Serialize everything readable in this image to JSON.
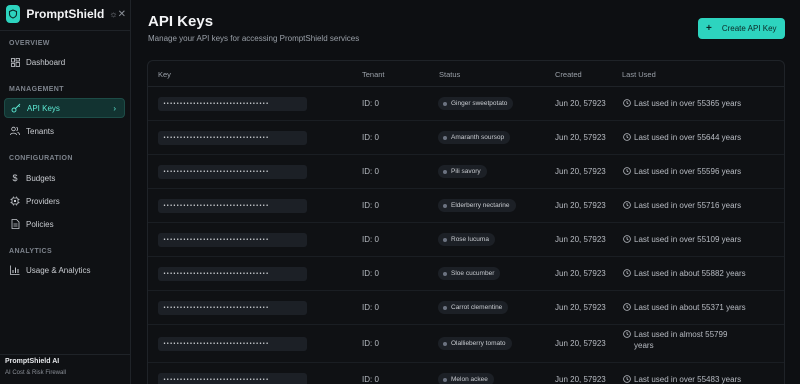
{
  "sidebar": {
    "brand": "PromptShield",
    "sections": {
      "overview": "OVERVIEW",
      "management": "MANAGEMENT",
      "configuration": "CONFIGURATION",
      "analytics": "ANALYTICS"
    },
    "items": {
      "dashboard": "Dashboard",
      "api_keys": "API Keys",
      "tenants": "Tenants",
      "budgets": "Budgets",
      "providers": "Providers",
      "policies": "Policies",
      "usage": "Usage & Analytics"
    },
    "footer": {
      "title": "PromptShield AI",
      "subtitle": "AI Cost & Risk Firewall"
    }
  },
  "header": {
    "title": "API Keys",
    "subtitle": "Manage your API keys for accessing PromptShield services",
    "create_button": "Create API Key"
  },
  "table": {
    "columns": [
      "Key",
      "Tenant",
      "Status",
      "Created",
      "Last Used"
    ],
    "rows": [
      {
        "key": "••••••••••••••••••••••••••••••••",
        "tenant": "ID: 0",
        "status": "Ginger sweetpotato",
        "created": "Jun 20, 57923",
        "last_used": "Last used in over 55365 years"
      },
      {
        "key": "••••••••••••••••••••••••••••••••",
        "tenant": "ID: 0",
        "status": "Amaranth soursop",
        "created": "Jun 20, 57923",
        "last_used": "Last used in over 55644 years"
      },
      {
        "key": "••••••••••••••••••••••••••••••••",
        "tenant": "ID: 0",
        "status": "Pili savory",
        "created": "Jun 20, 57923",
        "last_used": "Last used in over 55596 years"
      },
      {
        "key": "••••••••••••••••••••••••••••••••",
        "tenant": "ID: 0",
        "status": "Elderberry nectarine",
        "created": "Jun 20, 57923",
        "last_used": "Last used in over 55716 years"
      },
      {
        "key": "••••••••••••••••••••••••••••••••",
        "tenant": "ID: 0",
        "status": "Rose lucuma",
        "created": "Jun 20, 57923",
        "last_used": "Last used in over 55109 years"
      },
      {
        "key": "••••••••••••••••••••••••••••••••",
        "tenant": "ID: 0",
        "status": "Sloe cucumber",
        "created": "Jun 20, 57923",
        "last_used": "Last used in about 55882 years"
      },
      {
        "key": "••••••••••••••••••••••••••••••••",
        "tenant": "ID: 0",
        "status": "Carrot clementine",
        "created": "Jun 20, 57923",
        "last_used": "Last used in about 55371 years"
      },
      {
        "key": "••••••••••••••••••••••••••••••••",
        "tenant": "ID: 0",
        "status": "Olallieberry tomato",
        "created": "Jun 20, 57923",
        "last_used": "Last used in almost 55799 years"
      },
      {
        "key": "••••••••••••••••••••••••••••••••",
        "tenant": "ID: 0",
        "status": "Melon ackee",
        "created": "Jun 20, 57923",
        "last_used": "Last used in over 55483 years"
      }
    ]
  },
  "colors": {
    "accent": "#2dd4bf",
    "background": "#0d0f12"
  }
}
